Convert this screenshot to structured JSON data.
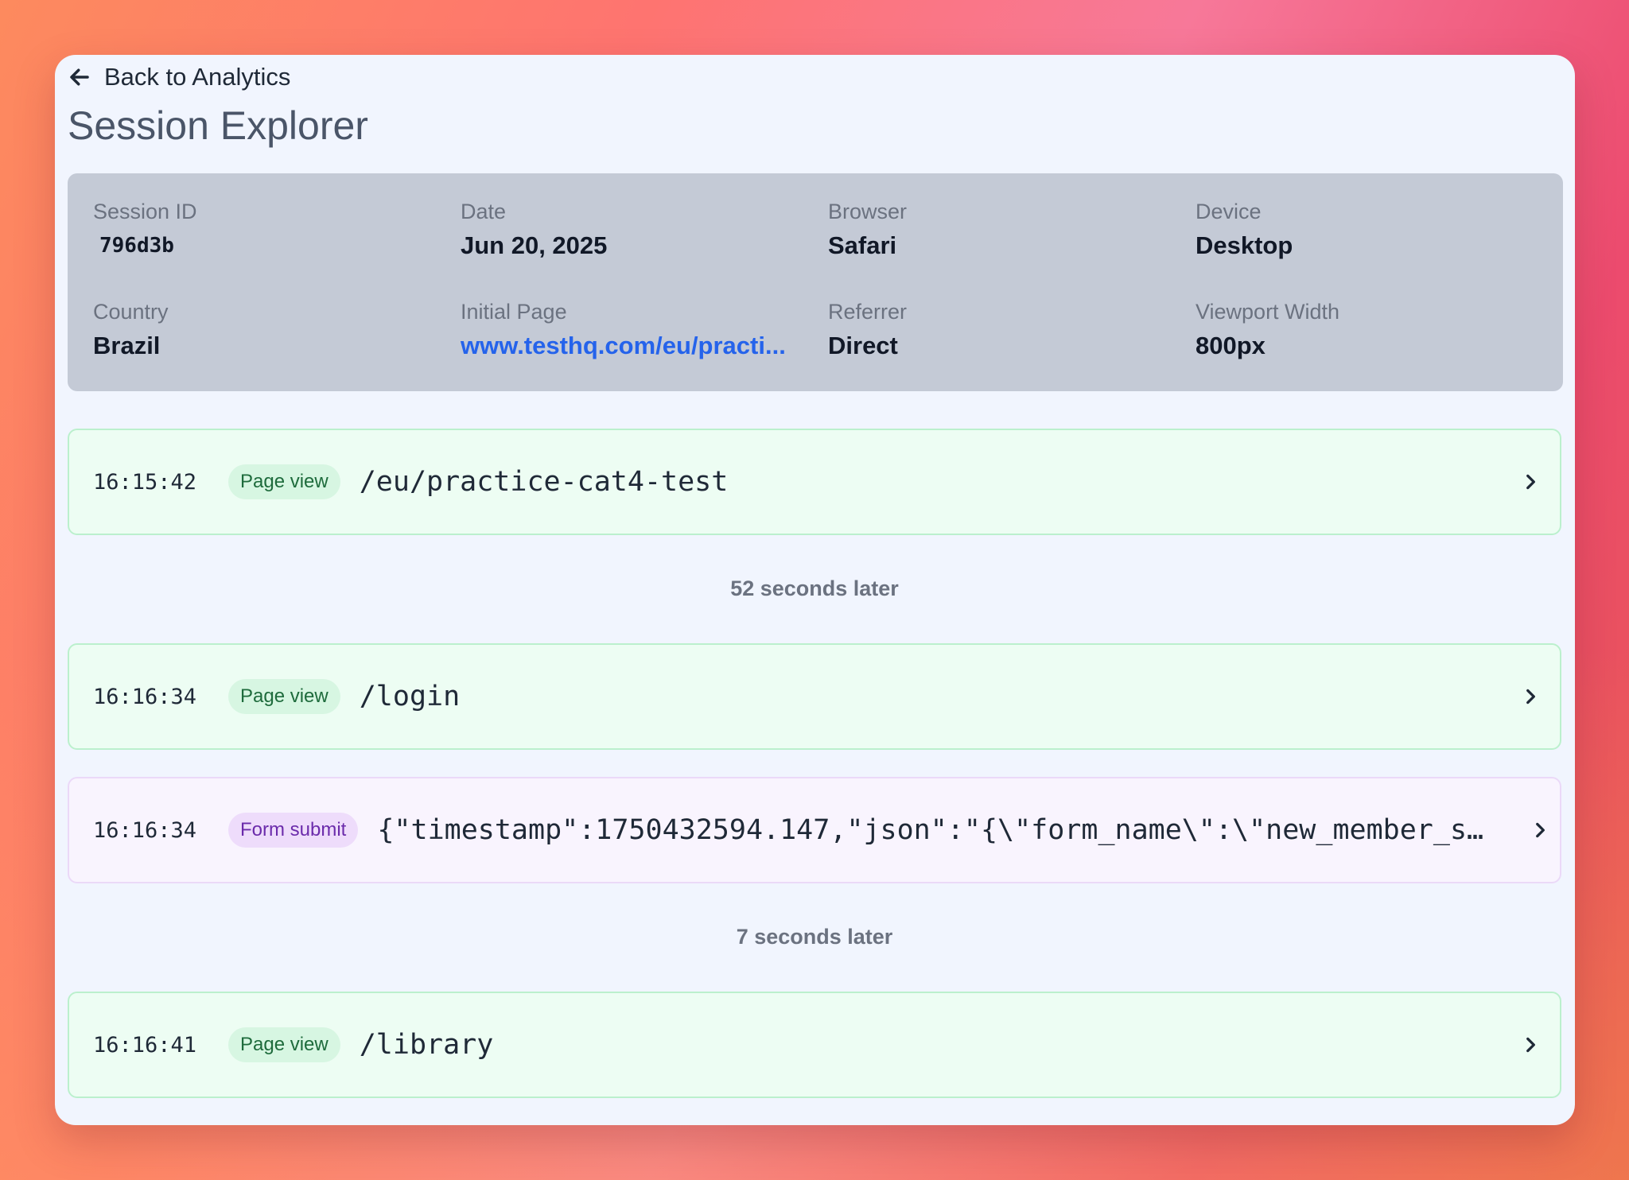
{
  "nav": {
    "back_label": "Back to Analytics"
  },
  "page": {
    "title": "Session Explorer"
  },
  "session": {
    "fields": [
      {
        "label": "Session ID",
        "value": "796d3b"
      },
      {
        "label": "Date",
        "value": "Jun 20, 2025"
      },
      {
        "label": "Browser",
        "value": "Safari"
      },
      {
        "label": "Device",
        "value": "Desktop"
      },
      {
        "label": "Country",
        "value": "Brazil"
      },
      {
        "label": "Initial Page",
        "value": "www.testhq.com/eu/practi..."
      },
      {
        "label": "Referrer",
        "value": "Direct"
      },
      {
        "label": "Viewport Width",
        "value": "800px"
      }
    ]
  },
  "events": [
    {
      "time": "16:15:42",
      "type": "Page view",
      "detail": "/eu/practice-cat4-test"
    },
    {
      "time": "16:16:34",
      "type": "Page view",
      "detail": "/login"
    },
    {
      "time": "16:16:34",
      "type": "Form submit",
      "detail": "{\"timestamp\":1750432594.147,\"json\":\"{\\\"form_name\\\":\\\"new_member_s…"
    },
    {
      "time": "16:16:41",
      "type": "Page view",
      "detail": "/library"
    }
  ],
  "gaps": [
    {
      "label": "52 seconds later"
    },
    {
      "label": "7 seconds later"
    }
  ],
  "colors": {
    "page_view_bg": "#edfdf3",
    "form_submit_bg": "#f9f4fe",
    "link": "#2563eb"
  },
  "icons": {
    "back": "arrow-left-icon",
    "row": "chevron-right-icon"
  }
}
